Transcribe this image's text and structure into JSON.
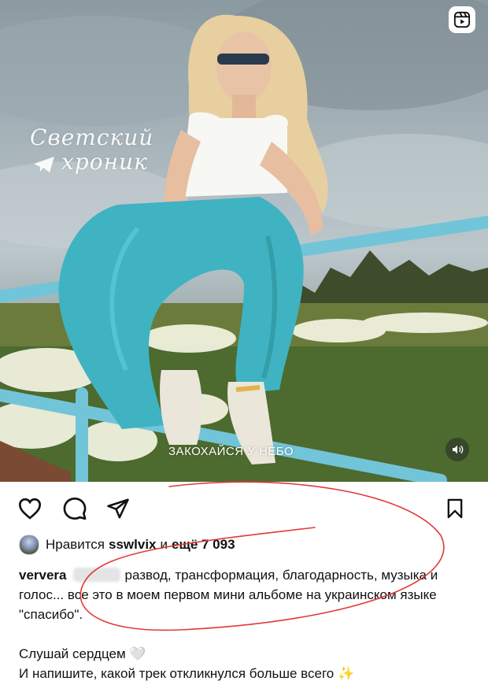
{
  "post": {
    "media": {
      "watermark_line1": "Светский",
      "watermark_line2": "хроник",
      "song_caption": "ЗАКОХАЙСЯ У НЕБО",
      "reels_icon": "reels-icon",
      "sound_icon": "sound-on-icon"
    },
    "actions": {
      "like_icon": "heart-icon",
      "comment_icon": "comment-icon",
      "share_icon": "send-icon",
      "save_icon": "bookmark-icon"
    },
    "likes": {
      "prefix": "Нравится",
      "user": "sswlvix",
      "conj": "и",
      "rest": "ещё 7 093"
    },
    "caption": {
      "username": "ververa",
      "text": "развод, трансформация, благодарность, музыка и голос... все это в моем первом мини альбоме на украинском языке \"спасибо\".",
      "line2": "Слушай сердцем 🤍",
      "line3": "И напишите, какой трек откликнулся больше всего ✨"
    },
    "colors": {
      "annotation": "#e03a3a",
      "pants": "#3fb3c1",
      "rail": "#6fc3d6"
    }
  }
}
